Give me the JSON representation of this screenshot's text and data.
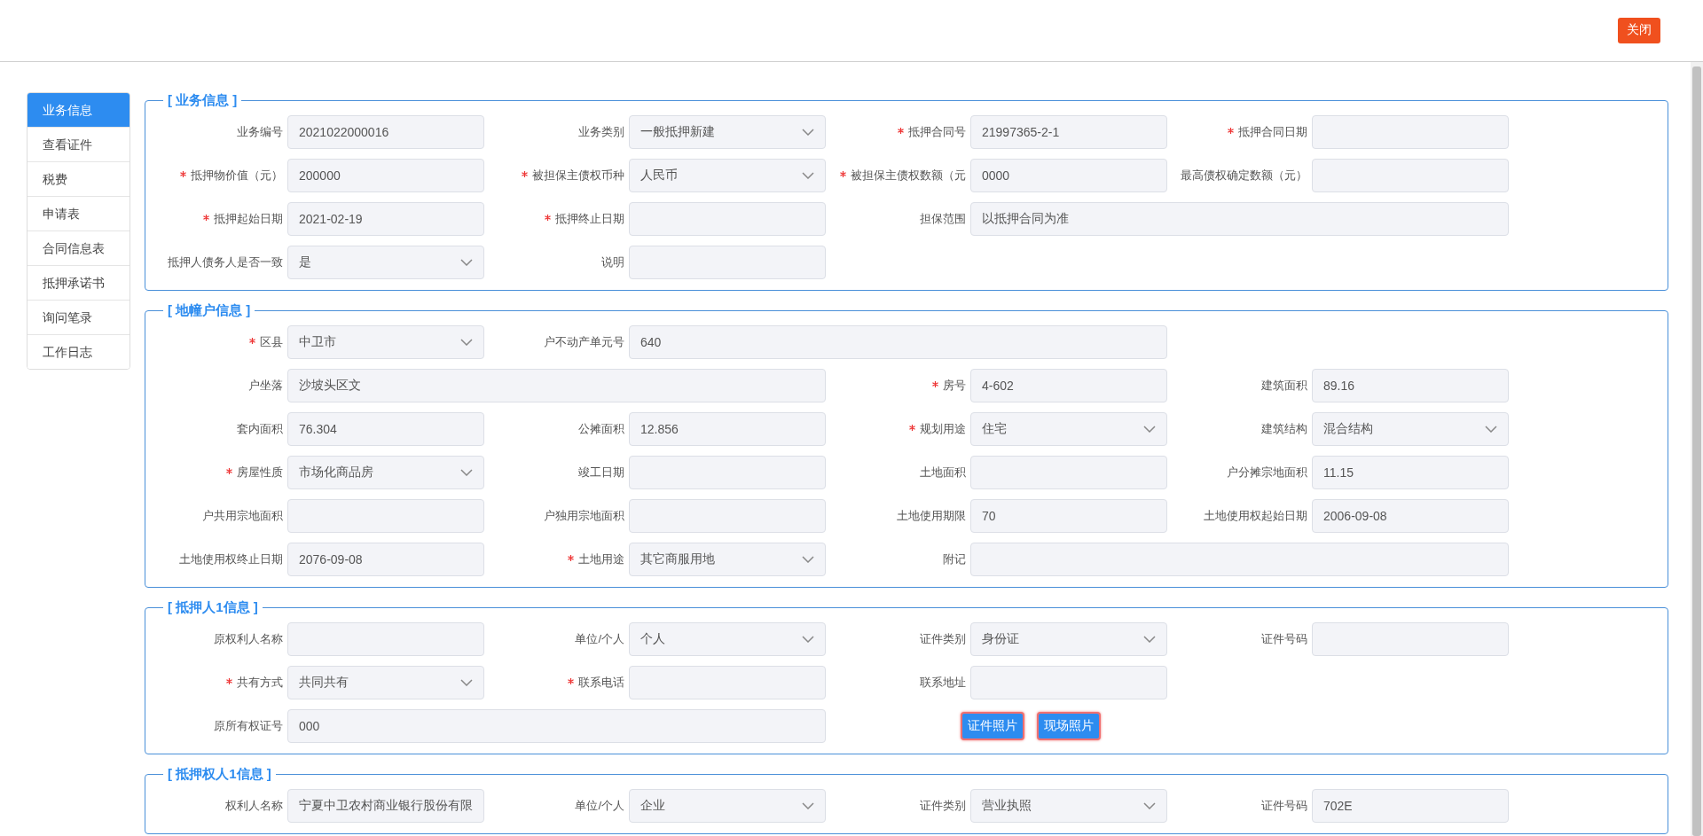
{
  "header": {
    "close_button": "关闭"
  },
  "sidebar": {
    "items": [
      {
        "label": "业务信息",
        "selected": true
      },
      {
        "label": "查看证件",
        "selected": false
      },
      {
        "label": "税费",
        "selected": false
      },
      {
        "label": "申请表",
        "selected": false
      },
      {
        "label": "合同信息表",
        "selected": false
      },
      {
        "label": "抵押承诺书",
        "selected": false
      },
      {
        "label": "询问笔录",
        "selected": false
      },
      {
        "label": "工作日志",
        "selected": false
      }
    ]
  },
  "sections": [
    {
      "title": "[ 业务信息 ]",
      "fields": [
        {
          "label": "业务编号",
          "required": false,
          "kind": "text",
          "value": "2021022000016"
        },
        {
          "label": "业务类别",
          "required": false,
          "kind": "select",
          "value": "一般抵押新建"
        },
        {
          "label": "抵押合同号",
          "required": true,
          "kind": "text",
          "value": "21997365-2-1"
        },
        {
          "label": "抵押合同日期",
          "required": true,
          "kind": "text"
        },
        {
          "label": "抵押物价值（元）",
          "required": true,
          "kind": "text",
          "value": "200000"
        },
        {
          "label": "被担保主债权币种",
          "required": true,
          "kind": "select",
          "value": "人民币"
        },
        {
          "label": "被担保主债权数额（元",
          "required": true,
          "kind": "text",
          "value": "0000"
        },
        {
          "label": "最高债权确定数额（元）",
          "required": false,
          "kind": "text"
        },
        {
          "label": "抵押起始日期",
          "required": true,
          "kind": "text",
          "value": "2021-02-19"
        },
        {
          "label": "抵押终止日期",
          "required": true,
          "kind": "text"
        },
        {
          "label": "担保范围",
          "required": false,
          "kind": "wide",
          "value": "以抵押合同为准"
        },
        {
          "label": "抵押人债务人是否一致",
          "required": false,
          "kind": "select",
          "value": "是"
        },
        {
          "label": "说明",
          "required": false,
          "kind": "text"
        }
      ]
    },
    {
      "title": "[ 地幢户信息 ]",
      "fields": [
        {
          "label": "区县",
          "required": true,
          "kind": "select",
          "value": "中卫市"
        },
        {
          "label": "户不动产单元号",
          "required": false,
          "kind": "wide",
          "value": "640"
        },
        {
          "label": "户坐落",
          "required": false,
          "kind": "wide",
          "value": "沙坡头区文"
        },
        {
          "label": "房号",
          "required": true,
          "kind": "text",
          "value": "4-602"
        },
        {
          "label": "建筑面积",
          "required": false,
          "kind": "text",
          "value": "89.16"
        },
        {
          "label": "套内面积",
          "required": false,
          "kind": "text",
          "value": "76.304"
        },
        {
          "label": "公摊面积",
          "required": false,
          "kind": "text",
          "value": "12.856"
        },
        {
          "label": "规划用途",
          "required": true,
          "kind": "select",
          "value": "住宅"
        },
        {
          "label": "建筑结构",
          "required": false,
          "kind": "select",
          "value": "混合结构"
        },
        {
          "label": "房屋性质",
          "required": true,
          "kind": "select",
          "value": "市场化商品房"
        },
        {
          "label": "竣工日期",
          "required": false,
          "kind": "text"
        },
        {
          "label": "土地面积",
          "required": false,
          "kind": "text"
        },
        {
          "label": "户分摊宗地面积",
          "required": false,
          "kind": "text",
          "value": "11.15"
        },
        {
          "label": "户共用宗地面积",
          "required": false,
          "kind": "text"
        },
        {
          "label": "户独用宗地面积",
          "required": false,
          "kind": "text"
        },
        {
          "label": "土地使用期限",
          "required": false,
          "kind": "text",
          "value": "70"
        },
        {
          "label": "土地使用权起始日期",
          "required": false,
          "kind": "text",
          "value": "2006-09-08"
        },
        {
          "label": "土地使用权终止日期",
          "required": false,
          "kind": "text",
          "value": "2076-09-08"
        },
        {
          "label": "土地用途",
          "required": true,
          "kind": "select",
          "value": "其它商服用地"
        },
        {
          "label": "附记",
          "required": false,
          "kind": "wide"
        }
      ]
    },
    {
      "title": "[ 抵押人1信息 ]",
      "fields": [
        {
          "label": "原权利人名称",
          "required": false,
          "kind": "text"
        },
        {
          "label": "单位/个人",
          "required": false,
          "kind": "select",
          "value": "个人"
        },
        {
          "label": "证件类别",
          "required": false,
          "kind": "select",
          "value": "身份证"
        },
        {
          "label": "证件号码",
          "required": false,
          "kind": "text"
        },
        {
          "label": "共有方式",
          "required": true,
          "kind": "select",
          "value": "共同共有"
        },
        {
          "label": "联系电话",
          "required": true,
          "kind": "text"
        },
        {
          "label": "联系地址",
          "required": false,
          "kind": "text"
        },
        {
          "label": "原所有权证号",
          "required": false,
          "kind": "wide",
          "value": "000"
        }
      ],
      "buttons": [
        "证件照片",
        "现场照片"
      ]
    },
    {
      "title": "[ 抵押权人1信息 ]",
      "fields": [
        {
          "label": "权利人名称",
          "required": false,
          "kind": "text",
          "value": "宁夏中卫农村商业银行股份有限"
        },
        {
          "label": "单位/个人",
          "required": false,
          "kind": "select",
          "value": "企业"
        },
        {
          "label": "证件类别",
          "required": false,
          "kind": "select",
          "value": "营业执照"
        },
        {
          "label": "证件号码",
          "required": false,
          "kind": "text",
          "value": "702E"
        }
      ]
    }
  ]
}
